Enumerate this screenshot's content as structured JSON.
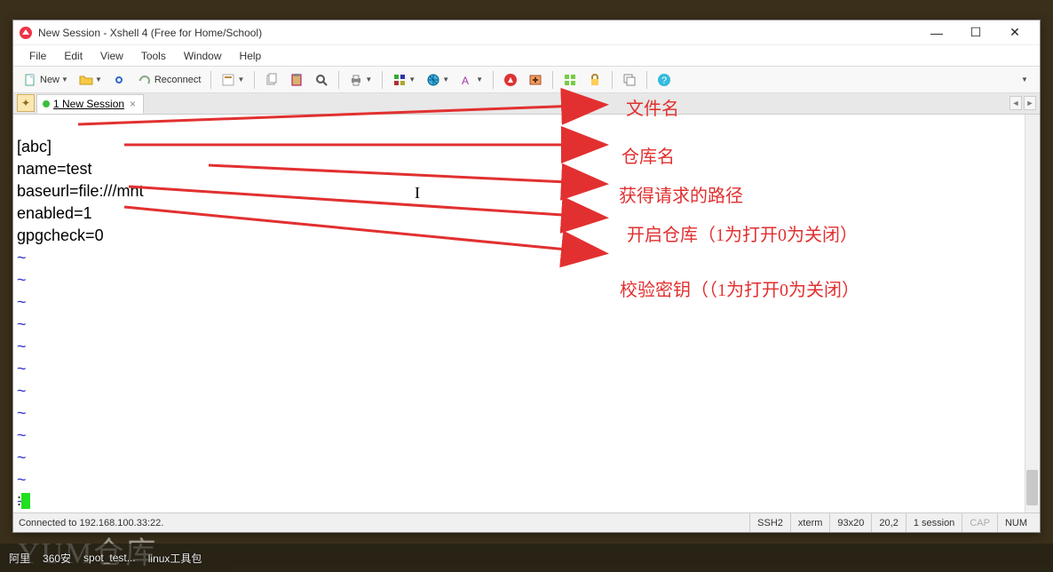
{
  "window": {
    "title": "New Session - Xshell 4 (Free for Home/School)"
  },
  "menu": {
    "file": "File",
    "edit": "Edit",
    "view": "View",
    "tools": "Tools",
    "window": "Window",
    "help": "Help"
  },
  "toolbar": {
    "new_label": "New",
    "reconnect_label": "Reconnect"
  },
  "tab": {
    "label": "1 New Session"
  },
  "terminal": {
    "lines": [
      "[abc]",
      "name=test",
      "baseurl=file:///mnt",
      "enabled=1",
      "gpgcheck=0"
    ],
    "tilde": "~",
    "prompt": ":"
  },
  "status": {
    "connected": "Connected to 192.168.100.33:22.",
    "proto": "SSH2",
    "term": "xterm",
    "size": "93x20",
    "pos": "20,2",
    "sessions": "1 session",
    "cap": "CAP",
    "num": "NUM"
  },
  "annotations": {
    "a1": "文件名",
    "a2": "仓库名",
    "a3": "获得请求的路径",
    "a4": "开启仓库（1为打开0为关闭）",
    "a5": "校验密钥（（1为打开0为关闭）"
  },
  "taskbar": {
    "i1": "阿里",
    "i2": "360安",
    "i3": "spot_test...",
    "i4": "linux工具包"
  },
  "watermark": "YUM仓库"
}
